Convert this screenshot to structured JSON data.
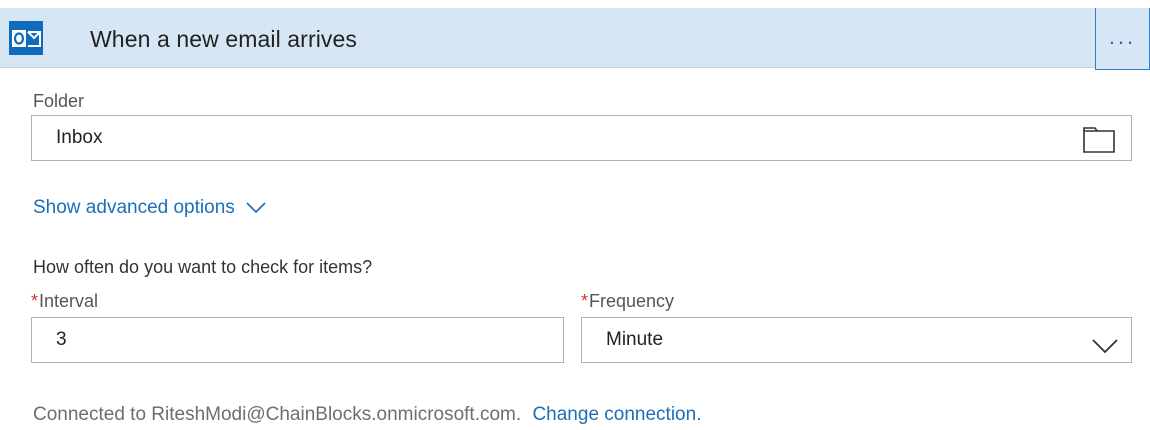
{
  "header": {
    "title": "When a new email arrives",
    "more_label": "...",
    "icon": "outlook-icon"
  },
  "folder": {
    "label": "Folder",
    "value": "Inbox",
    "icon": "folder-icon"
  },
  "advanced": {
    "link_label": "Show advanced options",
    "icon": "chevron-down-icon"
  },
  "schedule": {
    "question": "How often do you want to check for items?",
    "interval_label": "Interval",
    "interval_value": "3",
    "frequency_label": "Frequency",
    "frequency_value": "Minute",
    "required_marker": "*"
  },
  "footer": {
    "connected_text": "Connected to RiteshModi@ChainBlocks.onmicrosoft.com.",
    "change_link": "Change connection."
  },
  "colors": {
    "header_bg": "#d7e6f4",
    "accent": "#1a6fb8",
    "required": "#d13438",
    "outlook_blue": "#0f6cbd"
  }
}
